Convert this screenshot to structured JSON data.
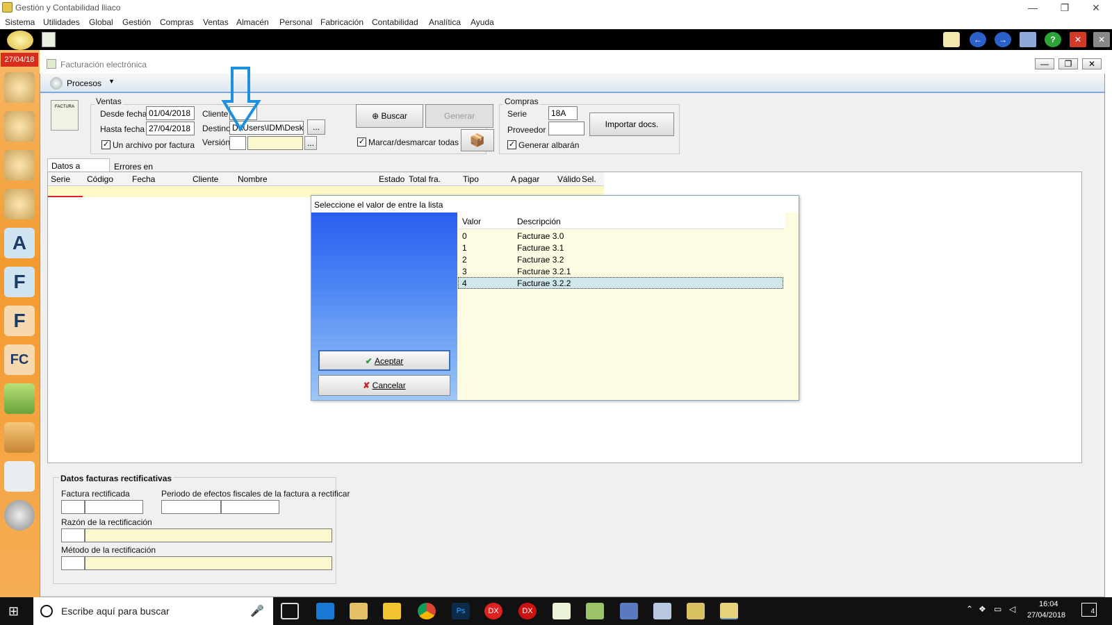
{
  "app": {
    "title": "Gestión y Contabilidad lliaco"
  },
  "window_controls": {
    "min": "—",
    "max": "❐",
    "close": "✕"
  },
  "menu": [
    "Sistema",
    "Utilidades",
    "Global",
    "Gestión",
    "Compras",
    "Ventas",
    "Almacén",
    "Personal",
    "Fabricación",
    "Contabilidad",
    "Analítica",
    "Ayuda"
  ],
  "sidebar": {
    "date": "27/04/18",
    "icons": [
      "A",
      "F",
      "F",
      "FC"
    ]
  },
  "window": {
    "title": "Facturación electrónica",
    "procesos": "Procesos"
  },
  "ventas": {
    "group": "Ventas",
    "desde_label": "Desde fecha",
    "desde": "01/04/2018",
    "hasta_label": "Hasta fecha",
    "hasta": "27/04/2018",
    "cliente_label": "Cliente",
    "destino_label": "Destino",
    "destino": "D:\\Users\\IDM\\Deskt",
    "version_label": "Versión",
    "un_archivo": "Un archivo por factura",
    "browse": "..."
  },
  "buttons": {
    "buscar": "Buscar",
    "generar": "Generar",
    "marcar": "Marcar/desmarcar todas",
    "importar": "Importar docs."
  },
  "compras": {
    "group": "Compras",
    "serie_label": "Serie",
    "serie": "18A",
    "proveedor_label": "Proveedor",
    "generar_albaran": "Generar albarán"
  },
  "tabs": [
    "Datos a exportar",
    "Errores en importación"
  ],
  "grid_headers": [
    "Serie",
    "Código",
    "Fecha",
    "Cliente",
    "Nombre",
    "Estado",
    "Total fra.",
    "Tipo",
    "A pagar",
    "Válido",
    "Sel."
  ],
  "dialog": {
    "title": "Seleccione el valor de entre la lista",
    "col_valor": "Valor",
    "col_desc": "Descripción",
    "rows": [
      {
        "v": "0",
        "d": "Facturae 3.0"
      },
      {
        "v": "1",
        "d": "Facturae 3.1"
      },
      {
        "v": "2",
        "d": "Facturae 3.2"
      },
      {
        "v": "3",
        "d": "Facturae 3.2.1"
      },
      {
        "v": "4",
        "d": "Facturae 3.2.2"
      }
    ],
    "selected": 4,
    "aceptar": "Aceptar",
    "cancelar": "Cancelar"
  },
  "rectificativas": {
    "title": "Datos facturas rectificativas",
    "factura": "Factura rectificada",
    "periodo": "Periodo de efectos fiscales de la factura a rectificar",
    "razon": "Razón de la rectificación",
    "metodo": "Método de la rectificación"
  },
  "taskbar": {
    "search_placeholder": "Escribe aquí para buscar",
    "time": "16:04",
    "date": "27/04/2018",
    "notif": "4"
  },
  "colors": {
    "accent": "#3b78e7",
    "highlight": "#f39a2f"
  }
}
